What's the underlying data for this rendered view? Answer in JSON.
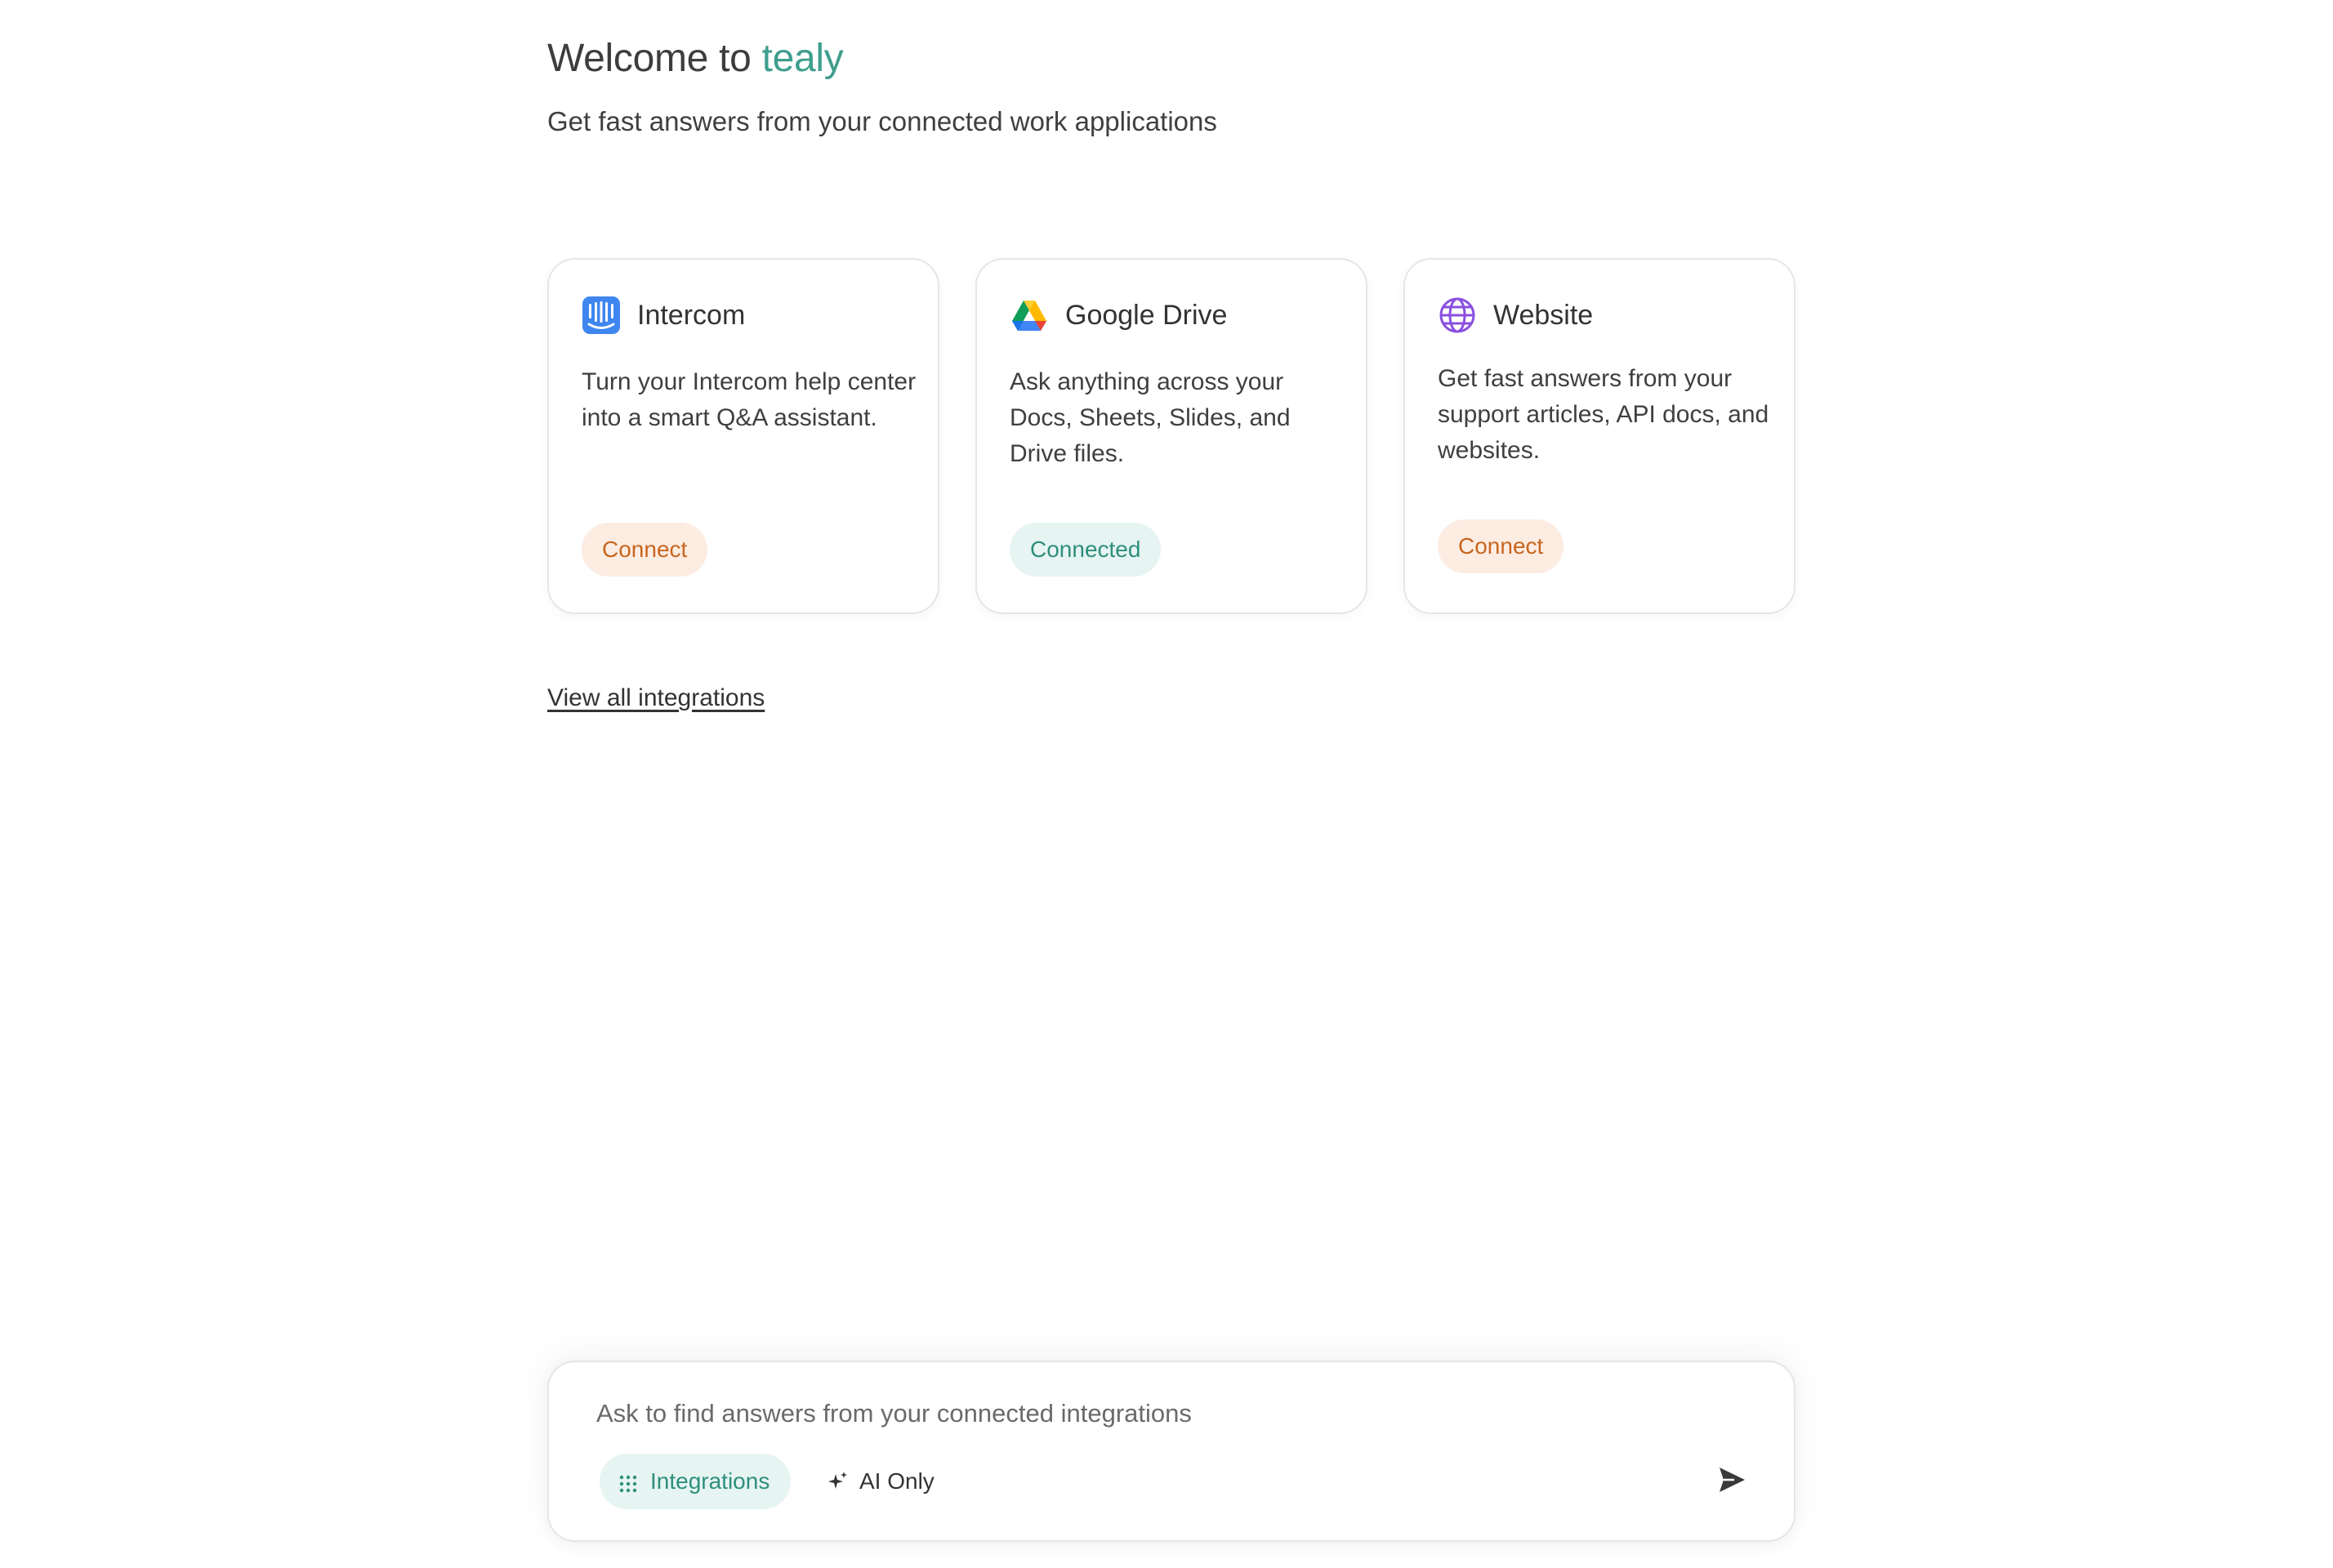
{
  "header": {
    "welcome_prefix": "Welcome to ",
    "brand_name": "tealy",
    "subtitle": "Get fast answers from your connected work applications"
  },
  "integrations": [
    {
      "title": "Intercom",
      "icon": "intercom-icon",
      "description": "Turn your Intercom help center into a smart Q&A assistant.",
      "status_label": "Connect",
      "status": "not-connected"
    },
    {
      "title": "Google Drive",
      "icon": "google-drive-icon",
      "description": "Ask anything across your Docs, Sheets, Slides, and Drive files.",
      "status_label": "Connected",
      "status": "connected"
    },
    {
      "title": "Website",
      "icon": "globe-icon",
      "description": "Get fast answers from your support articles, API docs, and websites.",
      "status_label": "Connect",
      "status": "not-connected"
    }
  ],
  "links": {
    "view_all": "View all integrations"
  },
  "composer": {
    "placeholder": "Ask to find answers from your connected integrations",
    "integrations_label": "Integrations",
    "ai_only_label": "AI Only"
  },
  "colors": {
    "brand_teal": "#3f9e8e",
    "connect_text": "#c8661f",
    "connect_bg": "#fcece2",
    "connected_text": "#2e8f7c",
    "connected_bg": "#e6f4f2",
    "intercom_blue": "#3f86f0",
    "website_purple": "#8a4fe0"
  }
}
